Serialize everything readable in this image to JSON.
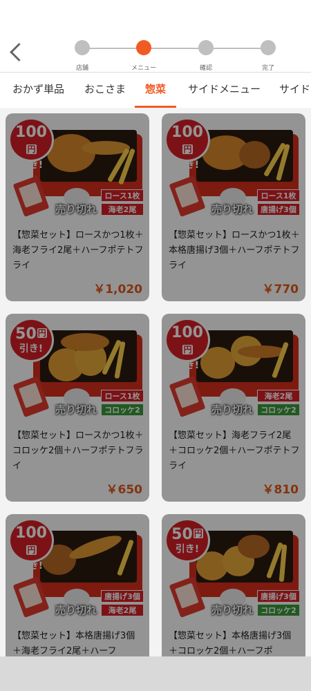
{
  "stepper": {
    "steps": [
      {
        "label": "店舗",
        "active": false
      },
      {
        "label": "メニュー",
        "active": true
      },
      {
        "label": "確認",
        "active": false
      },
      {
        "label": "完了",
        "active": false
      }
    ]
  },
  "tabs": [
    {
      "label": "おかず単品",
      "active": false
    },
    {
      "label": "おこさま",
      "active": false
    },
    {
      "label": "惣菜",
      "active": true
    },
    {
      "label": "サイドメニュー",
      "active": false
    },
    {
      "label": "サイド",
      "active": false
    }
  ],
  "colors": {
    "accent": "#f15a22",
    "price": "#e05a1a",
    "badge": "#d81f26",
    "tag_green": "#3a9a3a"
  },
  "products": [
    {
      "discount": {
        "amount": "100",
        "yen": "円",
        "off": "引き!"
      },
      "tags": [
        {
          "text": "ロース1枚",
          "color": "red"
        },
        {
          "text": "海老2尾",
          "color": "red"
        }
      ],
      "status": "売り切れ",
      "title": "【惣菜セット】ロースかつ1枚＋海老フライ2尾＋ハーフポテトフライ",
      "price": "￥1,020"
    },
    {
      "discount": {
        "amount": "100",
        "yen": "円",
        "off": "引き!"
      },
      "tags": [
        {
          "text": "ロース1枚",
          "color": "red"
        },
        {
          "text": "唐揚げ3個",
          "color": "red"
        }
      ],
      "status": "売り切れ",
      "title": "【惣菜セット】ロースかつ1枚＋本格唐揚げ3個＋ハーフポテトフライ",
      "price": "￥770"
    },
    {
      "discount": {
        "amount": "50",
        "yen": "円",
        "off": "引き!"
      },
      "tags": [
        {
          "text": "ロース1枚",
          "color": "red"
        },
        {
          "text": "コロッケ2個",
          "color": "green"
        }
      ],
      "status": "売り切れ",
      "title": "【惣菜セット】ロースかつ1枚＋コロッケ2個＋ハーフポテトフライ",
      "price": "￥650"
    },
    {
      "discount": {
        "amount": "100",
        "yen": "円",
        "off": "引き!"
      },
      "tags": [
        {
          "text": "海老2尾",
          "color": "red"
        },
        {
          "text": "コロッケ2個",
          "color": "green"
        }
      ],
      "status": "売り切れ",
      "title": "【惣菜セット】海老フライ2尾＋コロッケ2個＋ハーフポテトフライ",
      "price": "￥810"
    },
    {
      "discount": {
        "amount": "100",
        "yen": "円",
        "off": "引き!"
      },
      "tags": [
        {
          "text": "唐揚げ3個",
          "color": "red"
        },
        {
          "text": "海老2尾",
          "color": "red"
        }
      ],
      "status": "売り切れ",
      "title": "【惣菜セット】本格唐揚げ3個＋海老フライ2尾＋ハーフ",
      "price": ""
    },
    {
      "discount": {
        "amount": "50",
        "yen": "円",
        "off": "引き!"
      },
      "tags": [
        {
          "text": "唐揚げ3個",
          "color": "red"
        },
        {
          "text": "コロッケ2個",
          "color": "green"
        }
      ],
      "status": "売り切れ",
      "title": "【惣菜セット】本格唐揚げ3個＋コロッケ2個＋ハーフポ",
      "price": ""
    }
  ]
}
